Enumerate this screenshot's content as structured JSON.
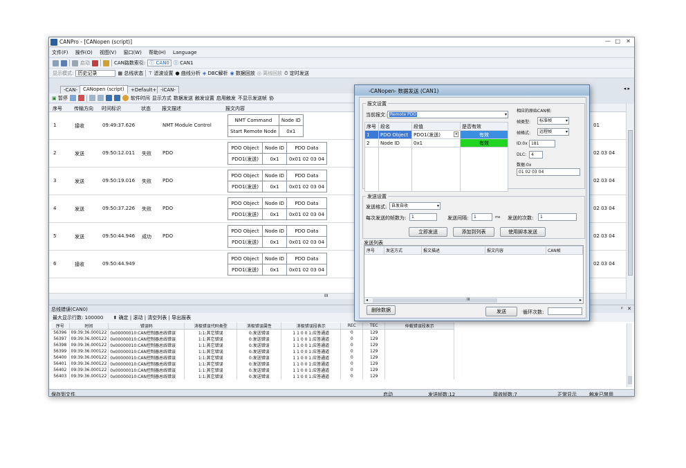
{
  "window": {
    "title": "CANPro - [CANopen (script)]",
    "controls": [
      "—",
      "□",
      "✕"
    ]
  },
  "menu": [
    "文件(F)",
    "操作(O)",
    "视图(V)",
    "窗口(W)",
    "帮助(H)",
    "Language"
  ],
  "toolbar1": {
    "start": "启动",
    "can_label": "CAN路数索引:",
    "can0": "CAN0",
    "can1": "CAN1"
  },
  "toolbar2": {
    "display_mode": "显示模式:",
    "history": "历史记录",
    "bus_status": "总线状态",
    "filter": "滤波设置",
    "curve": "曲线分析",
    "dbc": "DBC解析",
    "playback": "数据回放",
    "offline": "离线回放",
    "timed": "定时发送"
  },
  "tabs": [
    "-CAN-",
    "CANopen (script)",
    "+Default+",
    "-iCAN-"
  ],
  "toolbar3": {
    "pause": "暂停",
    "software_time": "软件时间",
    "display_mode": "显示方式",
    "data_send": "数据发送",
    "trigger": "触发设置",
    "enable_trigger": "启用触发",
    "no_send_frame": "不显示发送帧",
    "protocol": "协"
  },
  "main": {
    "headers": [
      "序号",
      "传输方向",
      "时间标识",
      "状态",
      "报文描述",
      "报文内容"
    ],
    "rows": [
      {
        "idx": "1",
        "dir": "接收",
        "time": "09:49:37.626",
        "status": "",
        "desc": "NMT Module Control",
        "t": [
          [
            "NMT Command",
            "Node ID"
          ],
          [
            "Start Remote Node",
            "0x1"
          ]
        ],
        "tail": "01"
      },
      {
        "idx": "2",
        "dir": "发送",
        "time": "09:50:12.011",
        "status": "失败",
        "desc": "PDO",
        "t": [
          [
            "PDO Object",
            "Node ID",
            "PDO Data"
          ],
          [
            "PDO1(发送)",
            "0x1",
            "0x01 02 03 04"
          ]
        ],
        "tail": "02 03 04"
      },
      {
        "idx": "3",
        "dir": "发送",
        "time": "09:50:19.016",
        "status": "失败",
        "desc": "PDO",
        "t": [
          [
            "PDO Object",
            "Node ID",
            "PDO Data"
          ],
          [
            "PDO1(发送)",
            "0x1",
            "0x01 02 03 04"
          ]
        ],
        "tail": "02 03 04"
      },
      {
        "idx": "4",
        "dir": "发送",
        "time": "09:50:37.226",
        "status": "失败",
        "desc": "PDO",
        "t": [
          [
            "PDO Object",
            "Node ID",
            "PDO Data"
          ],
          [
            "PDO1(发送)",
            "0x1",
            "0x01 02 03 04"
          ]
        ],
        "tail": "02 03 04"
      },
      {
        "idx": "5",
        "dir": "发送",
        "time": "09:50:44.946",
        "status": "成功",
        "desc": "PDO",
        "t": [
          [
            "PDO Object",
            "Node ID",
            "PDO Data"
          ],
          [
            "PDO1(发送)",
            "0x1",
            "0x01 02 03 04"
          ]
        ],
        "tail": "02 03 04"
      },
      {
        "idx": "6",
        "dir": "接收",
        "time": "09:50:44.949",
        "status": "",
        "desc": "",
        "t": [
          [
            "PDO Object",
            "Node ID",
            "PDO Data"
          ],
          [
            "PDO1(发送)",
            "0x1",
            "0x01 02 03 04"
          ]
        ],
        "tail": "02 03 04"
      }
    ],
    "scroll_mark": "III"
  },
  "bus": {
    "title": "总线错误(CAN0)",
    "pin": "ᵖ",
    "close": "✕",
    "max_rows_label": "最大显示行数: 100000",
    "confirm": "确定",
    "scroll": "滚动",
    "clear": "清空列表",
    "export": "导出报表",
    "headers": [
      "序号",
      "时间",
      "错误码",
      "消极错误代码类型",
      "消极错误属性",
      "消极错误段表示",
      "REC",
      "TEC",
      "仲裁错误段表示"
    ],
    "rows": [
      [
        "56396",
        "09:39:36.000122",
        "0x00000010:CAN控制器总线错误",
        "1:1:其它错误",
        "0:发送错误",
        "1 1 0 0 1:应答通道",
        "0",
        "129"
      ],
      [
        "56397",
        "09:39:36.000122",
        "0x00000010:CAN控制器总线错误",
        "1:1:其它错误",
        "0:发送错误",
        "1 1 0 0 1:应答通道",
        "0",
        "129"
      ],
      [
        "56398",
        "09:39:36.000122",
        "0x00000010:CAN控制器总线错误",
        "1:1:其它错误",
        "0:发送错误",
        "1 1 0 0 1:应答通道",
        "0",
        "129"
      ],
      [
        "56399",
        "09:39:36.000122",
        "0x00000010:CAN控制器总线错误",
        "1:1:其它错误",
        "0:发送错误",
        "1 1 0 0 1:应答通道",
        "0",
        "129"
      ],
      [
        "56400",
        "09:39:36.000122",
        "0x00000010:CAN控制器总线错误",
        "1:1:其它错误",
        "0:发送错误",
        "1 1 0 0 1:应答通道",
        "0",
        "129"
      ],
      [
        "56401",
        "09:39:36.000122",
        "0x00000010:CAN控制器总线错误",
        "1:1:其它错误",
        "0:发送错误",
        "1 1 0 0 1:应答通道",
        "0",
        "129"
      ],
      [
        "56402",
        "09:39:36.000122",
        "0x00000010:CAN控制器总线错误",
        "1:1:其它错误",
        "0:发送错误",
        "1 1 0 0 1:应答通道",
        "0",
        "129"
      ],
      [
        "56403",
        "09:39:36.000122",
        "0x00000010:CAN控制器总线错误",
        "1:1:其它错误",
        "0:发送错误",
        "1 1 0 0 1:应答通道",
        "0",
        "129"
      ]
    ]
  },
  "status": {
    "save": "保存到文件",
    "start": "启动",
    "sent": "发送帧数:12",
    "recv": "接收帧数:7",
    "normal": "正常显示",
    "trigger": "触发已禁用"
  },
  "dialog": {
    "title": "-CANopen- 数据发送 (CAN1)",
    "min": "—",
    "max": "□",
    "close": "✕",
    "msg_group": "报文设置",
    "current_label": "当前报文:",
    "current_value": "Remote PDO",
    "param_headers": [
      "序号",
      "段名",
      "段值",
      "是否有效"
    ],
    "param_rows": [
      [
        "1",
        "PDO Object",
        "PDO1(发送)",
        "有效"
      ],
      [
        "2",
        "Node ID",
        "0x1",
        "有效"
      ]
    ],
    "orig_label": "相应的原始CAN帧:",
    "frame_type_label": "帧类型:",
    "frame_type": "标准帧",
    "frame_fmt_label": "帧格式:",
    "frame_fmt": "远程帧",
    "id_label": "ID:0x",
    "id_value": "181",
    "dlc_label": "DLC:",
    "dlc_value": "4",
    "data_label": "数据:0x",
    "data_value": "01 02 03 04",
    "send_group": "发送设置",
    "send_fmt_label": "发送格式:",
    "send_fmt": "自发自收",
    "frames_label": "每次发送的帧数为:",
    "frames_value": "1",
    "interval_label": "发送间隔:",
    "interval_value": "1",
    "ms": "ms",
    "count_label": "发送的次数:",
    "count_value": "1",
    "btn_send_now": "立即发送",
    "btn_add_list": "添加到列表",
    "btn_script": "使用脚本发送",
    "list_label": "发送列表",
    "list_headers": [
      "序号",
      "发送方式",
      "报文描述",
      "报文内容",
      "CAN帧"
    ],
    "hscroll": "III",
    "btn_delete": "删除数据",
    "btn_send": "发送",
    "loop_label": "循环次数:"
  },
  "colors": {
    "valid_blue": "#3c8fe0",
    "valid_green": "#22d322",
    "select_blue": "#3b78d8"
  }
}
